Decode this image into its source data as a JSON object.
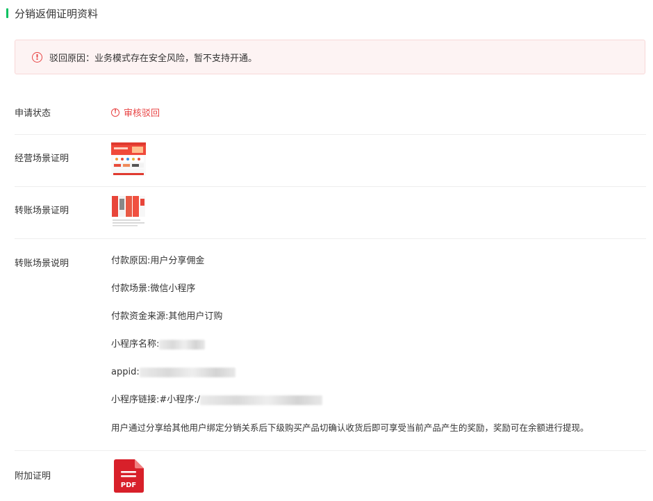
{
  "section": {
    "title": "分销返佣证明资料"
  },
  "alert": {
    "icon": "exclamation-circle-icon",
    "text": "驳回原因：业务模式存在安全风险，暂不支持开通。",
    "color": "#e84444"
  },
  "rows": {
    "status": {
      "label": "申请状态",
      "value": "审核驳回"
    },
    "business_scene": {
      "label": "经营场景证明"
    },
    "transfer_scene": {
      "label": "转账场景证明"
    },
    "transfer_desc": {
      "label": "转账场景说明",
      "lines": {
        "reason": "付款原因:用户分享佣金",
        "scene": "付款场景:微信小程序",
        "source": "付款资金来源:其他用户订购",
        "mini_name": "小程序名称:",
        "appid": "appid:",
        "link": "小程序链接:#小程序:/",
        "detail": "用户通过分享给其他用户绑定分销关系后下级购买产品切确认收货后即可享受当前产品产生的奖励，奖励可在余额进行提现。"
      }
    },
    "extra_proof": {
      "label": "附加证明",
      "file_type": "PDF"
    }
  },
  "colors": {
    "accent": "#07c160",
    "danger": "#e84444",
    "pdf": "#d8202a"
  }
}
